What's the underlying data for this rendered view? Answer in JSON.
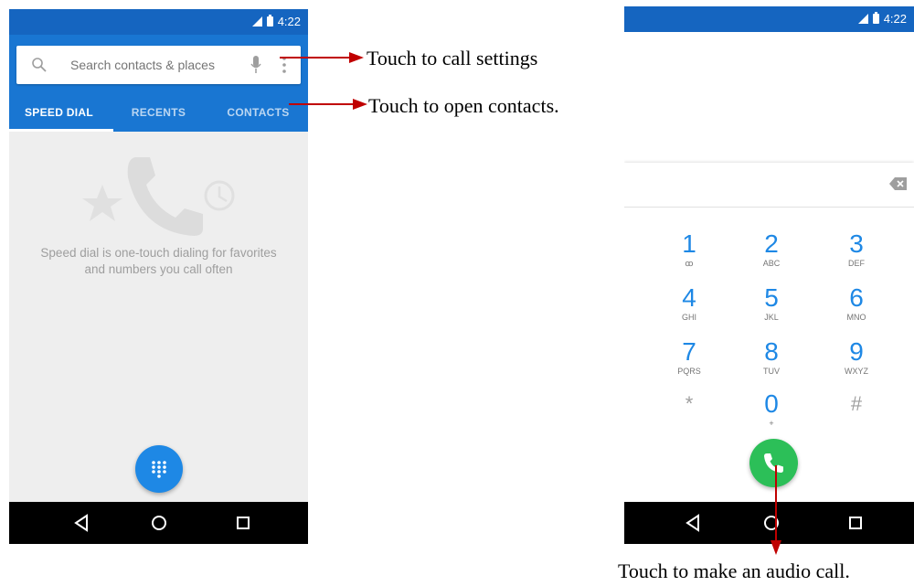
{
  "left_screen": {
    "status_time": "4:22",
    "search_placeholder": "Search contacts & places",
    "tabs": [
      "SPEED DIAL",
      "RECENTS",
      "CONTACTS"
    ],
    "empty_state_line1": "Speed dial is one-touch dialing for favorites",
    "empty_state_line2": "and numbers you call often"
  },
  "right_screen": {
    "status_time": "4:22",
    "keys": [
      {
        "num": "1",
        "letters": "ꝏ"
      },
      {
        "num": "2",
        "letters": "ABC"
      },
      {
        "num": "3",
        "letters": "DEF"
      },
      {
        "num": "4",
        "letters": "GHI"
      },
      {
        "num": "5",
        "letters": "JKL"
      },
      {
        "num": "6",
        "letters": "MNO"
      },
      {
        "num": "7",
        "letters": "PQRS"
      },
      {
        "num": "8",
        "letters": "TUV"
      },
      {
        "num": "9",
        "letters": "WXYZ"
      },
      {
        "num": "*",
        "letters": ""
      },
      {
        "num": "0",
        "letters": "+"
      },
      {
        "num": "#",
        "letters": ""
      }
    ]
  },
  "annotations": {
    "call_settings": "Touch to call settings",
    "open_contacts": "Touch to open contacts.",
    "audio_call": "Touch to make an audio call."
  },
  "colors": {
    "status_bar": "#1565c0",
    "app_bar": "#1976d2",
    "accent_blue": "#1e88e5",
    "call_green": "#2cbf58",
    "arrow_red": "#c00000"
  }
}
